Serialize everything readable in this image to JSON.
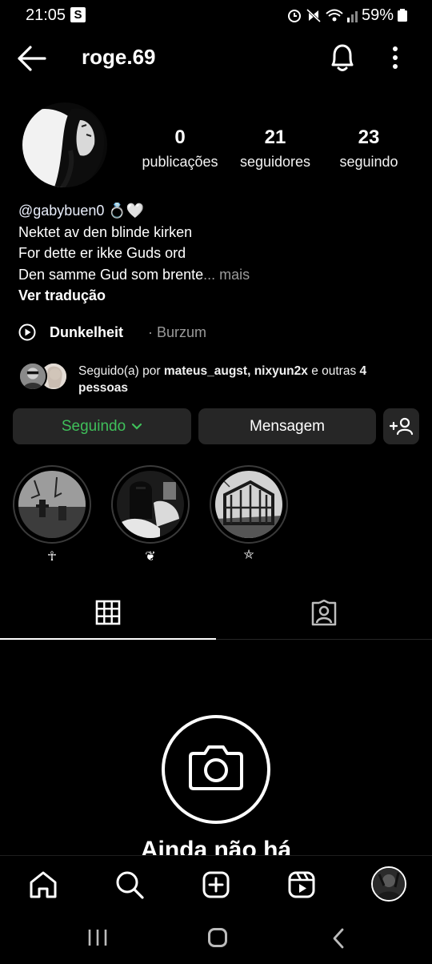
{
  "status_bar": {
    "time": "21:05",
    "badge": "S",
    "battery_percent": "59%"
  },
  "header": {
    "username": "roge.69"
  },
  "profile": {
    "stats": [
      {
        "value": "0",
        "label": "publicações"
      },
      {
        "value": "21",
        "label": "seguidores"
      },
      {
        "value": "23",
        "label": "seguindo"
      }
    ],
    "bio": {
      "handle": "@gabybuen0 💍🤍",
      "lines": [
        "Nektet av den blinde kirken",
        "For dette er ikke Guds ord",
        "Den samme Gud som brente"
      ],
      "ellipsis": "...",
      "more": " mais",
      "translate": "Ver tradução"
    },
    "music": {
      "song": "Dunkelheit",
      "artist": "· Burzum"
    },
    "followed_by": {
      "prefix": "Seguido(a) por ",
      "names": "mateus_augst, nixyun2x",
      "middle": " e outras ",
      "count": "4 pessoas"
    }
  },
  "actions": {
    "following_label": "Seguindo",
    "message_label": "Mensagem"
  },
  "highlights": [
    {
      "label": "☥"
    },
    {
      "label": "❦"
    },
    {
      "label": "⛤"
    }
  ],
  "empty_state": {
    "title": "Ainda não há"
  },
  "colors": {
    "background": "#000000",
    "button_bg": "#262626",
    "following_green": "#3fbf5a",
    "muted": "#9a9a9a"
  },
  "icons": {
    "back": "arrow-left-icon",
    "notifications": "bell-icon",
    "options": "kebab-icon",
    "music": "play-circle-icon",
    "add_person": "person-add-icon",
    "grid": "grid-icon",
    "tagged": "tagged-icon",
    "camera": "camera-icon",
    "nav": [
      "home-icon",
      "search-icon",
      "add-icon",
      "reels-icon",
      "profile-avatar"
    ]
  }
}
